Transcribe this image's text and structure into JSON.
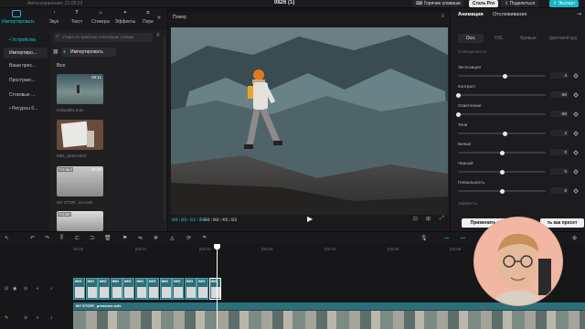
{
  "topbar": {
    "autosave": "Автосохранение: 21:00:23",
    "project_title": "0826 (1)",
    "hotkeys": "Горячие клавиши",
    "pro": "Стать Pro",
    "share": "Поделиться",
    "export": "Экспорт"
  },
  "media_tabs": [
    {
      "label": "Импортировать",
      "icon": "import-icon"
    },
    {
      "label": "Звук",
      "icon": "music-icon"
    },
    {
      "label": "Текст",
      "icon": "text-icon"
    },
    {
      "label": "Стикеры",
      "icon": "sticker-icon"
    },
    {
      "label": "Эффекты",
      "icon": "effects-icon"
    },
    {
      "label": "Пере",
      "icon": "transition-icon"
    }
  ],
  "left_nav": [
    {
      "label": "• Устройство"
    },
    {
      "label": "Импортиро..."
    },
    {
      "label": "Ваши прес..."
    },
    {
      "label": "Пространс..."
    },
    {
      "label": "Стоковые ..."
    },
    {
      "label": "• Ресурсы б..."
    }
  ],
  "media": {
    "search_placeholder": "Поиск по файлам, ключевым словам",
    "import_label": "Импортировать",
    "section": "Все",
    "items": [
      {
        "duration": "00:11",
        "name": "Iceland01.m4v",
        "badge": ""
      },
      {
        "duration": "",
        "name": "IMG_1616.HEIC",
        "badge": ""
      },
      {
        "duration": "00:48",
        "name": "MY STOR...ice.m4v",
        "badge": "Готово!"
      },
      {
        "duration": "",
        "name": "",
        "badge": "Готов!"
      }
    ]
  },
  "player": {
    "title": "Плеер",
    "current_time": "00:00:02:08",
    "total_time": "00:00:45:03"
  },
  "inspector": {
    "tabs": [
      "Анимация",
      "Отслеживание"
    ],
    "subtabs": [
      "Осн.",
      "HSL",
      "Кривые",
      "Цветовой кру"
    ],
    "section_label": "Освещенность",
    "params": [
      {
        "label": "Экспозиция",
        "value": "4",
        "level": 0.54
      },
      {
        "label": "Контраст",
        "value": "-50",
        "level": 0.0
      },
      {
        "label": "Осветление",
        "value": "-50",
        "level": 0.0
      },
      {
        "label": "Тени",
        "value": "4",
        "level": 0.54
      },
      {
        "label": "Белый",
        "value": "0",
        "level": 0.5
      },
      {
        "label": "Черный",
        "value": "0",
        "level": 0.5
      },
      {
        "label": "Гениальность",
        "value": "0",
        "level": 0.5
      }
    ],
    "effects_label": "Эффекты",
    "apply_all": "Применить ко",
    "save_preset": "ть как пресет"
  },
  "timeline": {
    "ruler": [
      "00:00",
      "|00:01",
      "|00:02",
      "|00:03",
      "|00:04",
      "|00:05",
      "|00:06"
    ],
    "image_clip_label": "IMG",
    "main_clip_label": "MY STORY_presence.m4v",
    "image_clip_count": 12
  },
  "colors": {
    "accent": "#19c0d2",
    "export": "#18b6c8",
    "track_clip": "#2f6e78",
    "webcam_ring": "#f1b7a3"
  }
}
